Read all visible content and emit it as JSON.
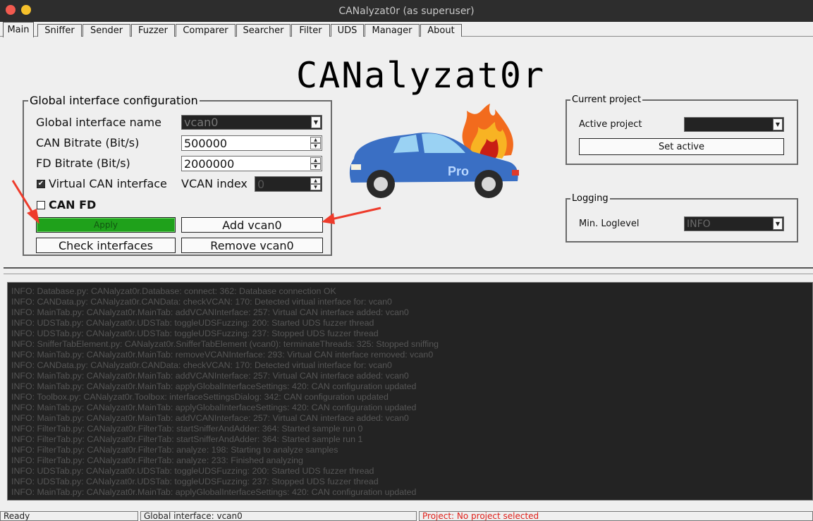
{
  "window": {
    "title": "CANalyzat0r (as superuser)"
  },
  "tabs": [
    {
      "label": "Main"
    },
    {
      "label": "Sniffer"
    },
    {
      "label": "Sender"
    },
    {
      "label": "Fuzzer"
    },
    {
      "label": "Comparer"
    },
    {
      "label": "Searcher"
    },
    {
      "label": "Filter"
    },
    {
      "label": "UDS"
    },
    {
      "label": "Manager"
    },
    {
      "label": "About"
    }
  ],
  "logo_text": "CANalyzat0r",
  "global_config": {
    "title": "Global interface configuration",
    "interface_name_label": "Global interface name",
    "interface_name_value": "vcan0",
    "can_bitrate_label": "CAN Bitrate (Bit/s)",
    "can_bitrate_value": "500000",
    "fd_bitrate_label": "FD Bitrate (Bit/s)",
    "fd_bitrate_value": "2000000",
    "virtual_can_label": "Virtual CAN interface",
    "virtual_can_checked": "✔",
    "vcan_index_label": "VCAN index",
    "vcan_index_value": "0",
    "can_fd_label": "CAN FD",
    "apply_label": "Apply",
    "add_vcan_label": "Add vcan0",
    "check_interfaces_label": "Check interfaces",
    "remove_vcan_label": "Remove vcan0"
  },
  "car_image": {
    "badge_text": "Pro"
  },
  "current_project": {
    "title": "Current project",
    "active_project_label": "Active project",
    "active_project_value": "",
    "set_active_label": "Set active"
  },
  "logging": {
    "title": "Logging",
    "min_loglevel_label": "Min. Loglevel",
    "min_loglevel_value": "INFO"
  },
  "log_lines": [
    "INFO: Database.py: CANalyzat0r.Database: connect: 362: Database connection OK",
    "INFO: CANData.py: CANalyzat0r.CANData: checkVCAN: 170: Detected virtual interface for: vcan0",
    "INFO: MainTab.py: CANalyzat0r.MainTab: addVCANInterface: 257: Virtual CAN interface added: vcan0",
    "INFO: UDSTab.py: CANalyzat0r.UDSTab: toggleUDSFuzzing: 200: Started UDS fuzzer thread",
    "INFO: UDSTab.py: CANalyzat0r.UDSTab: toggleUDSFuzzing: 237: Stopped UDS fuzzer thread",
    "INFO: SnifferTabElement.py: CANalyzat0r.SnifferTabElement (vcan0): terminateThreads: 325: Stopped sniffing",
    "INFO: MainTab.py: CANalyzat0r.MainTab: removeVCANInterface: 293: Virtual CAN interface removed: vcan0",
    "INFO: CANData.py: CANalyzat0r.CANData: checkVCAN: 170: Detected virtual interface for: vcan0",
    "INFO: MainTab.py: CANalyzat0r.MainTab: addVCANInterface: 257: Virtual CAN interface added: vcan0",
    "INFO: MainTab.py: CANalyzat0r.MainTab: applyGlobalInterfaceSettings: 420: CAN configuration updated",
    "INFO: Toolbox.py: CANalyzat0r.Toolbox: interfaceSettingsDialog: 342: CAN configuration updated",
    "INFO: MainTab.py: CANalyzat0r.MainTab: applyGlobalInterfaceSettings: 420: CAN configuration updated",
    "INFO: MainTab.py: CANalyzat0r.MainTab: addVCANInterface: 257: Virtual CAN interface added: vcan0",
    "INFO: FilterTab.py: CANalyzat0r.FilterTab: startSnifferAndAdder: 364: Started sample run 0",
    "INFO: FilterTab.py: CANalyzat0r.FilterTab: startSnifferAndAdder: 364: Started sample run 1",
    "INFO: FilterTab.py: CANalyzat0r.FilterTab: analyze: 198: Starting to analyze samples",
    "INFO: FilterTab.py: CANalyzat0r.FilterTab: analyze: 233: Finished analyzing",
    "INFO: UDSTab.py: CANalyzat0r.UDSTab: toggleUDSFuzzing: 200: Started UDS fuzzer thread",
    "INFO: UDSTab.py: CANalyzat0r.UDSTab: toggleUDSFuzzing: 237: Stopped UDS fuzzer thread",
    "INFO: MainTab.py: CANalyzat0r.MainTab: applyGlobalInterfaceSettings: 420: CAN configuration updated"
  ],
  "statusbar": {
    "status": "Ready",
    "global_interface": "Global interface: vcan0",
    "project": "Project: No project selected",
    "project_color": "#e0201a"
  },
  "colors": {
    "apply_button": "#1fa11b",
    "annotation_arrow": "#ee3b2b",
    "car_body": "#3a6fc4",
    "flame": "#f26b1d"
  }
}
